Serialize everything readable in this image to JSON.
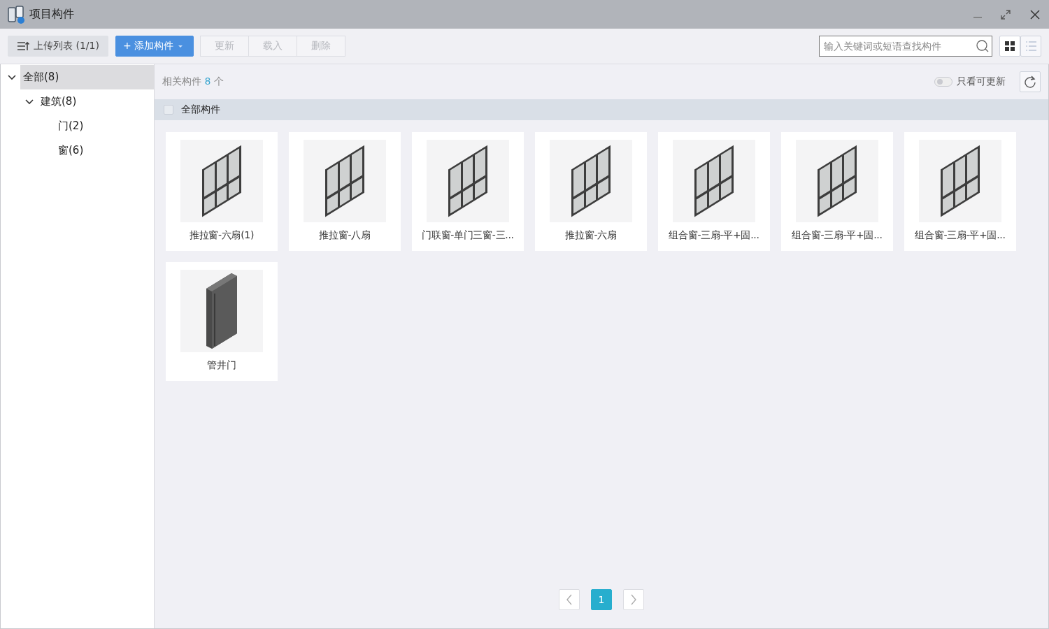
{
  "window": {
    "title": "项目构件"
  },
  "toolbar": {
    "buttons": [
      {
        "kind": "upload",
        "label": "上传列表 (1/1)",
        "disabled": false
      },
      {
        "kind": "add",
        "label": "+ 添加构件",
        "disabled": false
      },
      {
        "kind": "plain",
        "label": "更新",
        "disabled": true
      },
      {
        "kind": "plain",
        "label": "载入",
        "disabled": true
      },
      {
        "kind": "plain",
        "label": "删除",
        "disabled": true
      }
    ],
    "search": {
      "placeholder": "输入关键词或短语查找构件"
    },
    "views": [
      {
        "kind": "grid",
        "selected": true
      },
      {
        "kind": "list",
        "selected": false
      }
    ]
  },
  "tree": [
    {
      "label": "全部(8)",
      "selected": true,
      "expanded": true,
      "children": [
        {
          "label": "建筑(8)",
          "selected": false,
          "expanded": true,
          "children": [
            {
              "label": "门(2)",
              "selected": false
            },
            {
              "label": "窗(6)",
              "selected": false
            }
          ]
        }
      ]
    }
  ],
  "summary": {
    "prefix": "相关构件",
    "count": "8",
    "suffix": "个"
  },
  "filter": {
    "label": "只看可更新",
    "on": false
  },
  "select_all": {
    "label": "全部构件",
    "checked": false
  },
  "components": [
    {
      "name": "推拉窗-六扇(1)",
      "kind": "window"
    },
    {
      "name": "推拉窗-八扇",
      "kind": "window"
    },
    {
      "name": "门联窗-单门三窗-三...",
      "kind": "window"
    },
    {
      "name": "推拉窗-六扇",
      "kind": "window"
    },
    {
      "name": "组合窗-三扇-平+固...",
      "kind": "window"
    },
    {
      "name": "组合窗-三扇-平+固...",
      "kind": "window"
    },
    {
      "name": "组合窗-三扇-平+固...",
      "kind": "window"
    },
    {
      "name": "管井门",
      "kind": "door"
    }
  ],
  "pagination": {
    "pages": [
      {
        "label": "1",
        "selected": true
      }
    ]
  }
}
